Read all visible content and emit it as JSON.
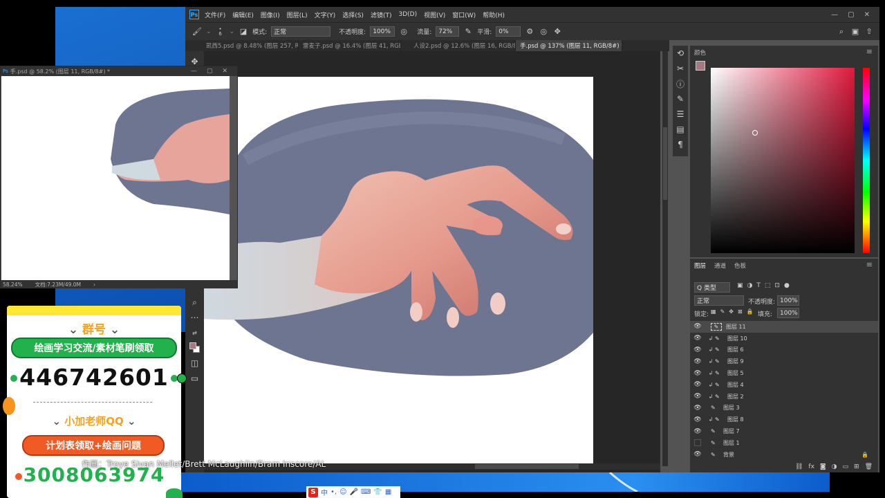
{
  "menubar": {
    "app_icon": "Ps",
    "items": [
      "文件(F)",
      "编辑(E)",
      "图像(I)",
      "图层(L)",
      "文字(Y)",
      "选择(S)",
      "滤镜(T)",
      "3D(D)",
      "视图(V)",
      "窗口(W)",
      "帮助(H)"
    ],
    "window_buttons": [
      "—",
      "▢",
      "✕"
    ]
  },
  "options": {
    "mode_label": "模式:",
    "mode_value": "正常",
    "opacity_label": "不透明度:",
    "opacity_value": "100%",
    "flow_label": "流量:",
    "flow_value": "72%",
    "smooth_label": "平滑:",
    "smooth_value": "0%",
    "brush_size": "6"
  },
  "tabs": [
    {
      "label": "凯西5.psd @ 8.48% (图层 257, RGB/8#)",
      "active": false
    },
    {
      "label": "雷麦子.psd @ 16.4% (图层 41, RGB/...",
      "active": false
    },
    {
      "label": "人设2.psd @ 12.6% (图层 16, RGB/8#)",
      "active": false
    },
    {
      "label": "手.psd @ 137% (图层 11, RGB/8#) *",
      "active": true
    }
  ],
  "color_panel": {
    "tab": "颜色"
  },
  "layers_panel": {
    "tabs": [
      "图层",
      "通道",
      "色板"
    ],
    "kind_filter": "Q 类型",
    "blend_mode": "正常",
    "opacity_label": "不透明度:",
    "opacity_value": "100%",
    "lock_label": "锁定:",
    "fill_label": "填充:",
    "fill_value": "100%",
    "layers": [
      {
        "name": "图层 11",
        "selected": true,
        "clipped": false,
        "visible": true
      },
      {
        "name": "图层 10",
        "selected": false,
        "clipped": true,
        "visible": true
      },
      {
        "name": "图层 6",
        "selected": false,
        "clipped": true,
        "visible": true
      },
      {
        "name": "图层 9",
        "selected": false,
        "clipped": true,
        "visible": true
      },
      {
        "name": "图层 5",
        "selected": false,
        "clipped": true,
        "visible": true
      },
      {
        "name": "图层 4",
        "selected": false,
        "clipped": true,
        "visible": true
      },
      {
        "name": "图层 2",
        "selected": false,
        "clipped": true,
        "visible": true
      },
      {
        "name": "图层 3",
        "selected": false,
        "clipped": false,
        "visible": true
      },
      {
        "name": "图层 8",
        "selected": false,
        "clipped": true,
        "visible": true
      },
      {
        "name": "图层 7",
        "selected": false,
        "clipped": false,
        "visible": true
      },
      {
        "name": "图层 1",
        "selected": false,
        "clipped": false,
        "visible": false
      },
      {
        "name": "背景",
        "selected": false,
        "clipped": false,
        "visible": true
      }
    ]
  },
  "small_window": {
    "title": "手.psd @ 58.2% (图层 11, RGB/8#) *",
    "zoom": "58.24%",
    "doc_info": "文档:7.23M/49.0M"
  },
  "ad": {
    "heading1": "群号",
    "pill1": "绘画学习交流/素材笔刷领取",
    "number1": "446742601",
    "heading2": "小加老师QQ",
    "pill2": "计划表领取+绘画问题",
    "number2": "3008063974"
  },
  "credit": "作画：Troye Sivan Mellet/Brett McLaughlin/Bram Inscore/AL",
  "ime": {
    "label": "中"
  },
  "colors": {
    "panel_bg": "#323232",
    "canvas_bg": "#262626",
    "skin": "#e7a49a",
    "shadow_blob": "#6b7290",
    "ad_green": "#22b14c",
    "ad_orange": "#f05a24"
  }
}
